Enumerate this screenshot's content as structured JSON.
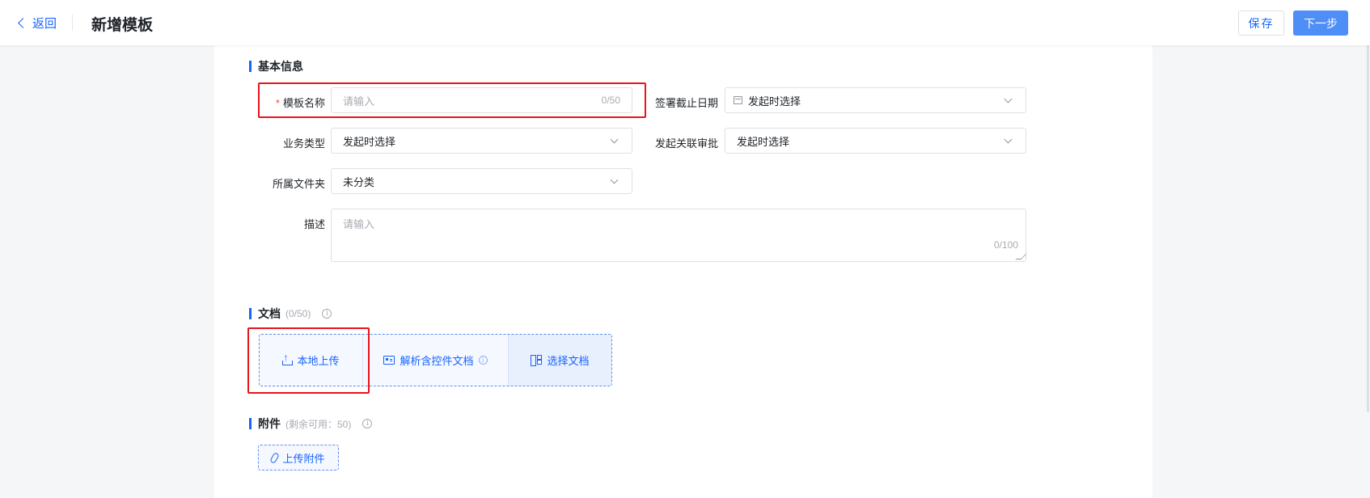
{
  "header": {
    "back_label": "返回",
    "title": "新增模板",
    "save_label": "保存",
    "next_label": "下一步"
  },
  "basic_info": {
    "section_title": "基本信息",
    "template_name": {
      "label": "模板名称",
      "placeholder": "请输入",
      "counter": "0/50"
    },
    "deadline": {
      "label": "签署截止日期",
      "value": "发起时选择"
    },
    "business_type": {
      "label": "业务类型",
      "value": "发起时选择"
    },
    "approval": {
      "label": "发起关联审批",
      "value": "发起时选择"
    },
    "folder": {
      "label": "所属文件夹",
      "value": "未分类"
    },
    "description": {
      "label": "描述",
      "placeholder": "请输入",
      "counter": "0/100"
    }
  },
  "documents": {
    "section_title": "文档",
    "count": "(0/50)",
    "local_upload": "本地上传",
    "parse_controls": "解析含控件文档",
    "choose_document": "选择文档"
  },
  "attachments": {
    "section_title": "附件",
    "remaining": "(剩余可用：50)",
    "upload_label": "上传附件"
  },
  "colors": {
    "accent": "#1664ff",
    "annotation": "#e8141a"
  }
}
